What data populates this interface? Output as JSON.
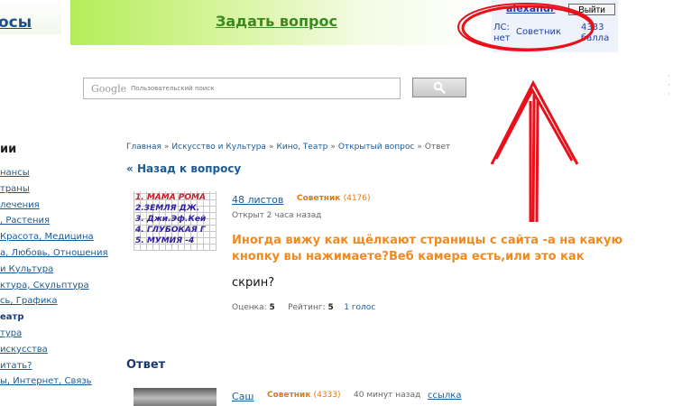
{
  "header": {
    "logo": "осы",
    "ask_link": "Задать вопрос",
    "user": {
      "name": "alexandr",
      "logout": "Выйти",
      "pm_line1": "ЛС:",
      "pm_line2": "нет",
      "rank": "Советник",
      "points_line1": "4333",
      "points_line2": "балла"
    }
  },
  "search": {
    "logo": "Google",
    "placeholder": "Пользовательский поиск",
    "button_icon": "magnifier-icon"
  },
  "sidebar": {
    "heading": "ии",
    "items": [
      {
        "label": "нансы",
        "current": false
      },
      {
        "label": "траны",
        "current": false
      },
      {
        "label": "лечения",
        "current": false
      },
      {
        "label": ", Растения",
        "current": false
      },
      {
        "label": "Красота, Медицина",
        "current": false
      },
      {
        "label": "а, Любовь, Отношения",
        "current": false
      },
      {
        "label": "и Культура",
        "current": false
      },
      {
        "label": "ктура, Скульптура",
        "current": false
      },
      {
        "label": "сь, Графика",
        "current": false
      },
      {
        "label": "еатр",
        "current": true
      },
      {
        "label": "тура",
        "current": false
      },
      {
        "label": "искусства",
        "current": false
      },
      {
        "label": "итать?",
        "current": false
      },
      {
        "label": "ы, Интернет, Связь",
        "current": false
      }
    ]
  },
  "breadcrumb": {
    "items": [
      "Главная",
      "Искусство и Культура",
      "Кино, Театр",
      "Открытый вопрос"
    ],
    "current": "Ответ",
    "separator": "»"
  },
  "back_link": {
    "arrow": "«",
    "label": "Назад к вопросу"
  },
  "question": {
    "avatar_lines": [
      "1. МАМА РОМА",
      "2.ЗЕМЛЯ ДЖ.",
      "3. Джи.Эф.Кей",
      "4. ГЛУБОКАЯ Г",
      "5. МУМИЯ -4"
    ],
    "author": "48 листов",
    "author_rank": "Советник",
    "author_points": "(4176)",
    "opened": "Открыт 2 часа назад",
    "title": "Иногда вижу как щёлкают страницы с сайта -а на какую кнопку вы нажимаете?Веб камера есть,или это как",
    "body": "скрин?",
    "score_label": "Оценка:",
    "score": "5",
    "rating_label": "Рейтинг:",
    "rating": "5",
    "votes": "1 голос"
  },
  "answer_section": {
    "heading": "Ответ",
    "author": "Саш",
    "rank": "Советник",
    "points": "(4333)",
    "time": "40 минут назад",
    "link": "ссылка"
  },
  "annotation_color": "#e8101a"
}
